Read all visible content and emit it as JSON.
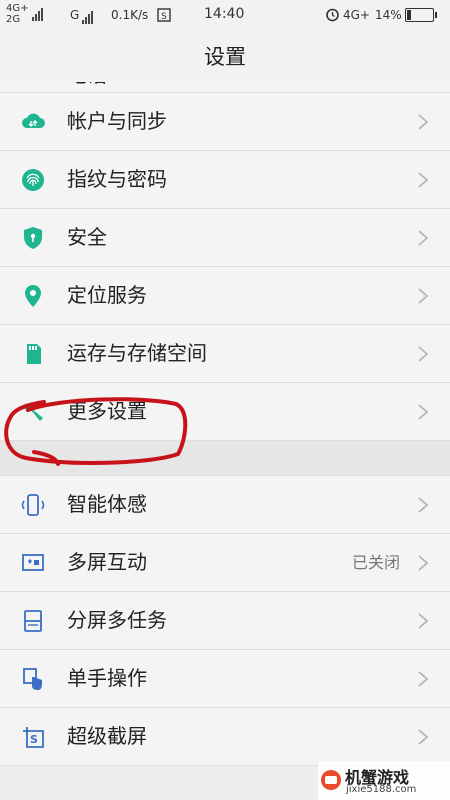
{
  "status": {
    "net1_top": "4G+",
    "net1_bottom": "2G",
    "net2": "G",
    "speed": "0.1K/s",
    "time": "14:40",
    "net3": "4G+",
    "battery": "14%",
    "battery_level": 0.14
  },
  "title": "设置",
  "partial_item": "电话",
  "group1": [
    {
      "label": "帐户与同步",
      "icon": "cloud-sync-icon"
    },
    {
      "label": "指纹与密码",
      "icon": "fingerprint-icon"
    },
    {
      "label": "安全",
      "icon": "shield-icon"
    },
    {
      "label": "定位服务",
      "icon": "location-pin-icon"
    },
    {
      "label": "运存与存储空间",
      "icon": "sd-card-icon"
    },
    {
      "label": "更多设置",
      "icon": "wrench-icon"
    }
  ],
  "group2": [
    {
      "label": "智能体感",
      "icon": "phone-motion-icon"
    },
    {
      "label": "多屏互动",
      "icon": "screen-cast-icon",
      "value": "已关闭"
    },
    {
      "label": "分屏多任务",
      "icon": "split-screen-icon"
    },
    {
      "label": "单手操作",
      "icon": "one-hand-icon"
    },
    {
      "label": "超级截屏",
      "icon": "screenshot-icon"
    }
  ],
  "watermark": {
    "name": "机蟹游戏",
    "url": "jixie5188.com"
  },
  "colors": {
    "accent": "#1fb58f",
    "blue_icon": "#3a6fc4",
    "annotation": "#c8121a"
  }
}
